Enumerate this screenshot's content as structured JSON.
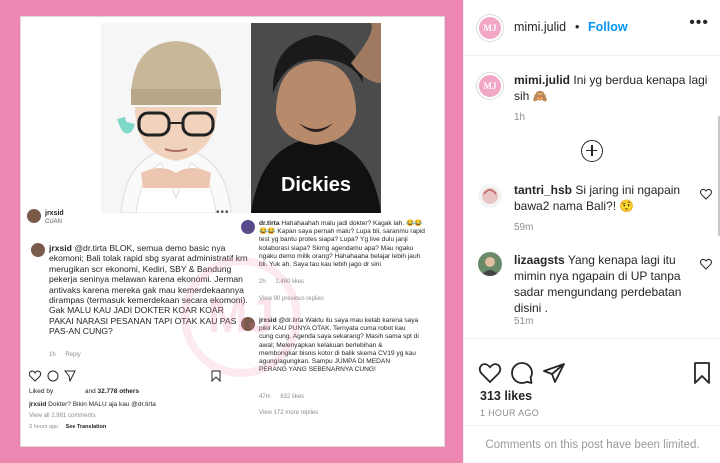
{
  "colors": {
    "frame": "#ee86b2",
    "link": "#0095f6",
    "muted": "#8e8e8e",
    "text": "#262626"
  },
  "post_image": {
    "account": "jrxsid",
    "account_sub": "CUAN",
    "big_comment_user": "jrxsid",
    "big_comment_text": "@dr.tirta BLOK, semua demo basic nya ekomoni; Bali tolak rapid sbg syarat administratif krn merugikan scr ekonomi, Kediri, SBY & Bandung pekerja seninya melawan karena ekonomi. Jerman antivaks karena mereka gak mau kemerdekaannya dirampas (termasuk kemerdekaan secara ekomoni). Gak MALU KAU JADI DOKTER KOAR KOAR PAKAI NARASI PESANAN TAPI OTAK KAU PAS PAS-AN CUNG?",
    "big_comment_time": "1h",
    "big_comment_reply": "Reply",
    "reply1_user": "dr.tirta",
    "reply1_text": "Hahahaahah malu jadi dokter? Kagak lah. 😂😂😂😂 Kapan saya pernah malu? Lupa bli, saranmu rapid test yg bantu protes siapa? Lupa? Yg live dulu janji kolaborasi siapa? Skrng agendamu apa? Mau ngaku ngaku demo milik orang? Hahahaaha belajar lebih jauh bli. Yuk ah. Saya tau kau lebih jago dr sini",
    "reply1_time": "2h",
    "reply1_likes": "1,460 likes",
    "reply1_view": "View 90 previous replies",
    "reply2_user": "jrxsid",
    "reply2_text": "@dr.tirta Waktu itu saya mau kelab karena saya pikir KAU PUNYA OTAK. Ternyata cuma robot kau cung cung. Agenda saya sekarang? Masih sama spt di awal; Melenyapkan kelakuan berlebihan & membongkar bisnis kotor di balik skema CV19 yg kau agung/agungkan. Sampu JUMPA DI MEDAN PERANG YANG SEBENARNYA CUNG!",
    "reply2_time": "47m",
    "reply2_likes": "632 likes",
    "reply2_view": "View 172 more replies",
    "liked_by_prefix": "Liked by",
    "liked_by_and": "and",
    "liked_by_count": "32.778 others",
    "caption_user": "jrxsid",
    "caption_text": "Dokter? Bikin MALU aja kau @dr.tirta",
    "view_all": "View all 2.981 comments",
    "post_time": "3 hours ago",
    "see_translation": "See Translation",
    "watermark": "MJ"
  },
  "header": {
    "avatar_text": "MJ",
    "username": "mimi.julid",
    "separator": "•",
    "follow": "Follow",
    "more_icon": "more-horizontal-icon"
  },
  "comments": [
    {
      "user": "mimi.julid",
      "text": "Ini yg berdua kenapa lagi sih 🙈",
      "time": "1h"
    },
    {
      "user": "tantri_hsb",
      "text": "Si jaring ini ngapain bawa2 nama Bali?! 🤨",
      "time": "59m"
    },
    {
      "user": "lizaagsts",
      "text": "Yang kenapa lagi itu mimin nya ngapain di UP tanpa sadar mengundang perdebatan disini .",
      "time": "51m"
    }
  ],
  "actions": {
    "likes": "313 likes",
    "ago": "1 HOUR AGO",
    "limited": "Comments on this post have been limited."
  }
}
